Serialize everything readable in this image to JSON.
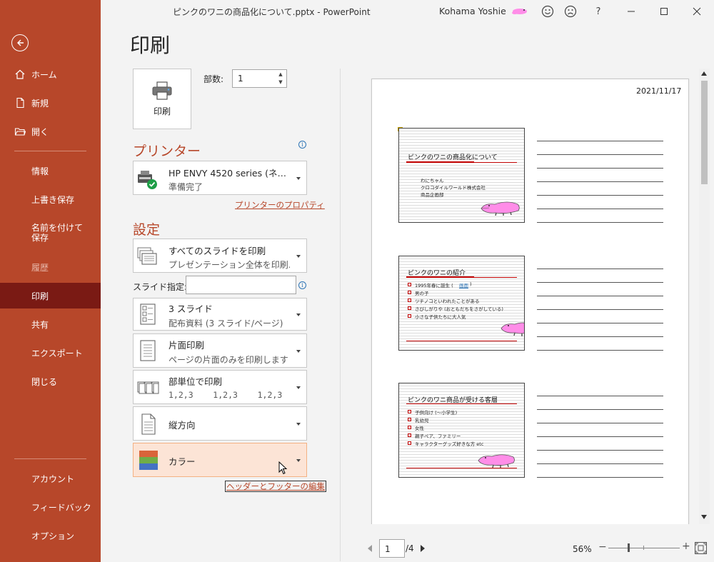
{
  "window": {
    "title": "ピンクのワニの商品化について.pptx  -  PowerPoint",
    "user": "Kohama Yoshie",
    "help": "?"
  },
  "sidebar": {
    "items": [
      {
        "label": "ホーム",
        "icon": "home-icon"
      },
      {
        "label": "新規",
        "icon": "new-document-icon"
      },
      {
        "label": "開く",
        "icon": "open-folder-icon"
      },
      {
        "label": "情報"
      },
      {
        "label": "上書き保存"
      },
      {
        "label": "名前を付けて保存"
      },
      {
        "label": "履歴",
        "disabled": true
      },
      {
        "label": "印刷",
        "active": true
      },
      {
        "label": "共有"
      },
      {
        "label": "エクスポート"
      },
      {
        "label": "閉じる"
      },
      {
        "label": "アカウント"
      },
      {
        "label": "フィードバック"
      },
      {
        "label": "オプション"
      }
    ]
  },
  "print": {
    "heading": "印刷",
    "button_label": "印刷",
    "copies_label": "部数:",
    "copies_value": "1"
  },
  "printer": {
    "heading": "プリンター",
    "name": "HP ENVY 4520 series (ネ…",
    "status": "準備完了",
    "properties_link": "プリンターのプロパティ"
  },
  "settings": {
    "heading": "設定",
    "range": {
      "main": "すべてのスライドを印刷",
      "sub": "プレゼンテーション全体を印刷…"
    },
    "slides_label": "スライド指定:",
    "slides_value": "",
    "layout": {
      "main": "3 スライド",
      "sub": "配布資料 (3 スライド/ページ)"
    },
    "sides": {
      "main": "片面印刷",
      "sub": "ページの片面のみを印刷します"
    },
    "collate": {
      "main": "部単位で印刷",
      "sub": "1,2,3    1,2,3    1,2,3"
    },
    "orientation": {
      "main": "縦方向"
    },
    "color": {
      "main": "カラー"
    },
    "header_footer_link": "ヘッダーとフッターの編集"
  },
  "preview": {
    "date": "2021/11/17",
    "slides": [
      {
        "title": "ピンクのワニの商品化について",
        "lines": [
          "わにちゃん",
          "クロコダイルワールド株式会社",
          "商品企画部"
        ]
      },
      {
        "title": "ピンクのワニの紹介",
        "bullets": [
          "1995年春に誕生 (",
          "男の子",
          "ツチノコといわれたことがある",
          "さびしがりや (おともだちをさがしている)",
          "小さな子供たちに大人気"
        ],
        "link": "画面"
      },
      {
        "title": "ピンクのワニ商品が受ける客層",
        "bullets": [
          "子供向け (～小学生)",
          "乳幼児",
          "女性",
          "親子ペア、ファミリー",
          "キャラクターグッズ好きな方  etc"
        ]
      }
    ]
  },
  "pager": {
    "current": "1",
    "total": "/4"
  },
  "zoom": {
    "level": "56%",
    "minus": "−",
    "plus": "+",
    "value_percent": 56
  },
  "colors": {
    "accent": "#b7472a",
    "sidebar_active": "#7a1a14",
    "hover_fill": "#fce4d6"
  }
}
